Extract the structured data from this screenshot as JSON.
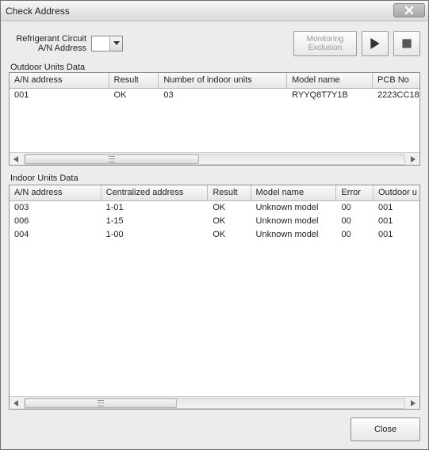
{
  "window": {
    "title": "Check Address"
  },
  "toolbar": {
    "label_line1": "Refrigerant Circuit",
    "label_line2": "A/N Address",
    "dropdown_value": "",
    "monitoring_line1": "Monitoring",
    "monitoring_line2": "Exclusion"
  },
  "outdoor": {
    "section_label": "Outdoor Units Data",
    "columns": [
      "A/N address",
      "Result",
      "Number of indoor units",
      "Model name",
      "PCB No"
    ],
    "rows": [
      {
        "addr": "001",
        "result": "OK",
        "numIndoor": "03",
        "model": "RYYQ8T7Y1B",
        "pcb": "2223CC18"
      }
    ]
  },
  "indoor": {
    "section_label": "Indoor Units Data",
    "columns": [
      "A/N address",
      "Centralized address",
      "Result",
      "Model name",
      "Error",
      "Outdoor u"
    ],
    "rows": [
      {
        "addr": "003",
        "caddr": "1-01",
        "result": "OK",
        "model": "Unknown model",
        "error": "00",
        "outdoor": "001"
      },
      {
        "addr": "006",
        "caddr": "1-15",
        "result": "OK",
        "model": "Unknown model",
        "error": "00",
        "outdoor": "001"
      },
      {
        "addr": "004",
        "caddr": "1-00",
        "result": "OK",
        "model": "Unknown model",
        "error": "00",
        "outdoor": "001"
      }
    ]
  },
  "footer": {
    "close_label": "Close"
  }
}
